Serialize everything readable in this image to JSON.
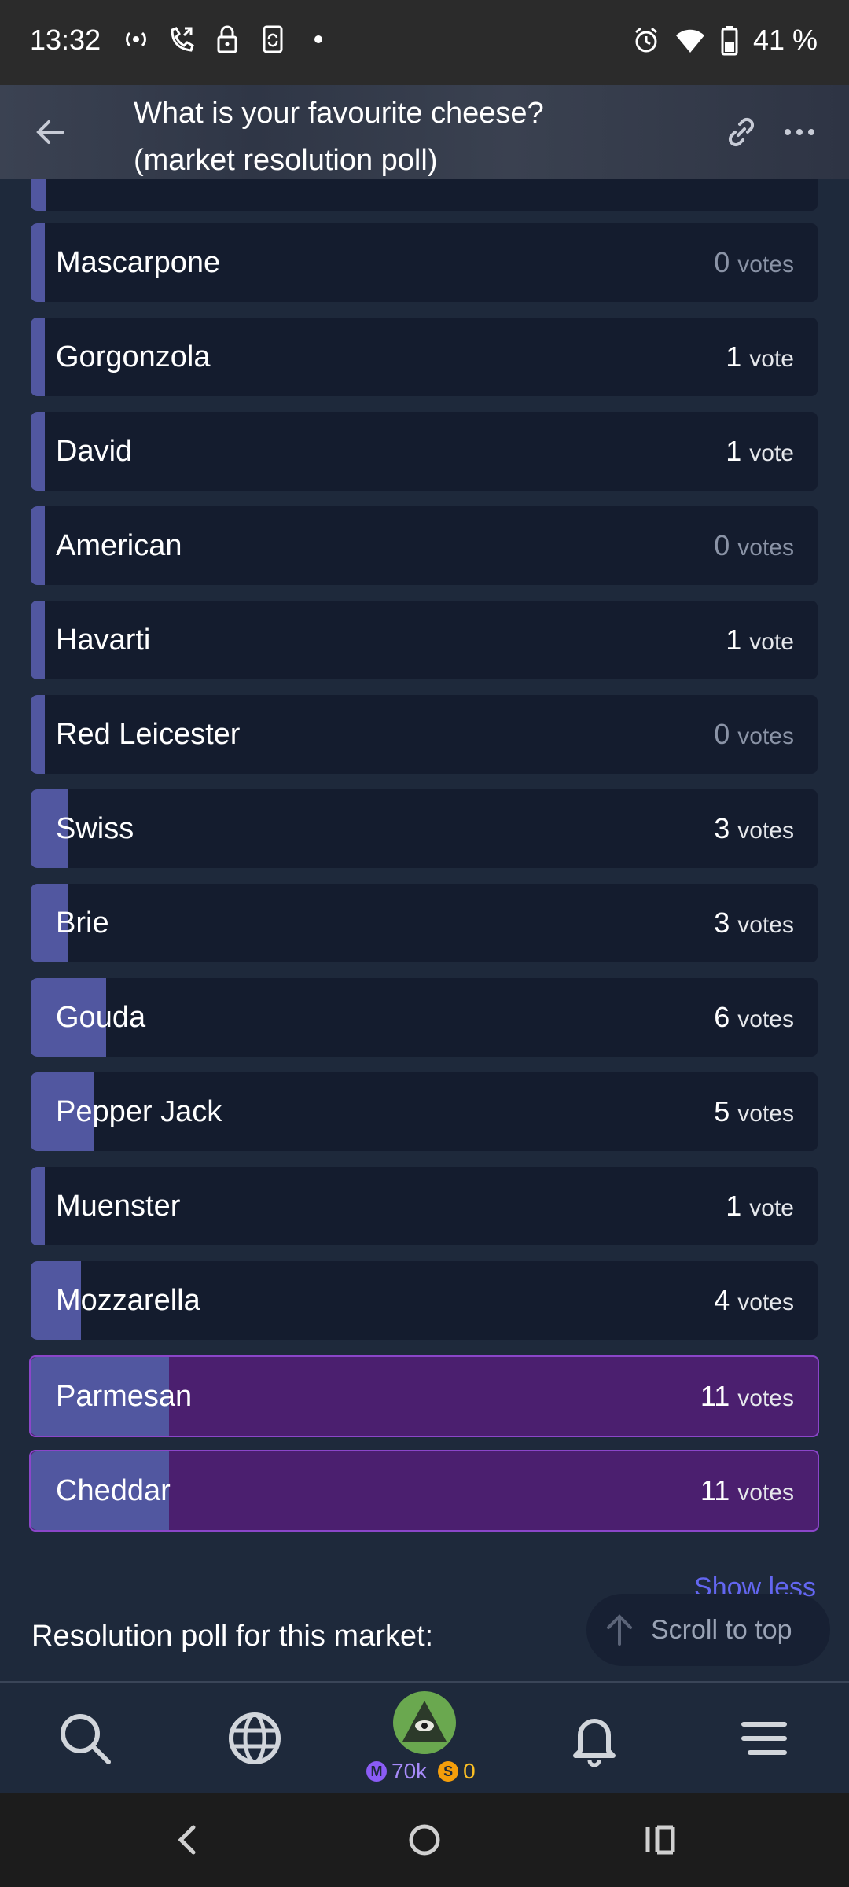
{
  "status_bar": {
    "time": "13:32",
    "battery": "41 %",
    "icons": [
      "hotspot-icon",
      "wifi-calling-icon",
      "lock-icon",
      "phone-sync-icon",
      "dot-icon",
      "alarm-icon",
      "wifi-icon",
      "battery-icon"
    ]
  },
  "header": {
    "title_line1": "What is your favourite cheese?",
    "title_line2": "(market resolution poll)",
    "back_icon": "arrow-left-icon",
    "link_icon": "link-icon",
    "more_icon": "more-horizontal-icon"
  },
  "poll": {
    "max_votes": 11,
    "options": [
      {
        "label": "Mascarpone",
        "votes": "0",
        "unit": "votes",
        "value": 0
      },
      {
        "label": "Gorgonzola",
        "votes": "1",
        "unit": "vote",
        "value": 1
      },
      {
        "label": "David",
        "votes": "1",
        "unit": "vote",
        "value": 1
      },
      {
        "label": "American",
        "votes": "0",
        "unit": "votes",
        "value": 0
      },
      {
        "label": "Havarti",
        "votes": "1",
        "unit": "vote",
        "value": 1
      },
      {
        "label": "Red Leicester",
        "votes": "0",
        "unit": "votes",
        "value": 0
      },
      {
        "label": "Swiss",
        "votes": "3",
        "unit": "votes",
        "value": 3
      },
      {
        "label": "Brie",
        "votes": "3",
        "unit": "votes",
        "value": 3
      },
      {
        "label": "Gouda",
        "votes": "6",
        "unit": "votes",
        "value": 6
      },
      {
        "label": "Pepper Jack",
        "votes": "5",
        "unit": "votes",
        "value": 5
      },
      {
        "label": "Muenster",
        "votes": "1",
        "unit": "vote",
        "value": 1
      },
      {
        "label": "Mozzarella",
        "votes": "4",
        "unit": "votes",
        "value": 4
      },
      {
        "label": "Parmesan",
        "votes": "11",
        "unit": "votes",
        "value": 11,
        "top": true
      },
      {
        "label": "Cheddar",
        "votes": "11",
        "unit": "votes",
        "value": 11,
        "top": true
      }
    ]
  },
  "show_less": "Show less",
  "resolution_text": "Resolution poll for this market:",
  "scroll_to_top": "Scroll to top",
  "bottom_nav": {
    "items": [
      "search-icon",
      "globe-icon",
      "avatar",
      "bell-icon",
      "menu-icon"
    ],
    "mana_balance": "70k",
    "sweep_balance": "0",
    "mana_symbol": "M",
    "sweep_symbol": "S"
  },
  "colors": {
    "background": "#1e293b",
    "row": "#141c2e",
    "fill": "#5157a0",
    "top_row": "#4b1f6f",
    "accent": "#6366f1"
  }
}
